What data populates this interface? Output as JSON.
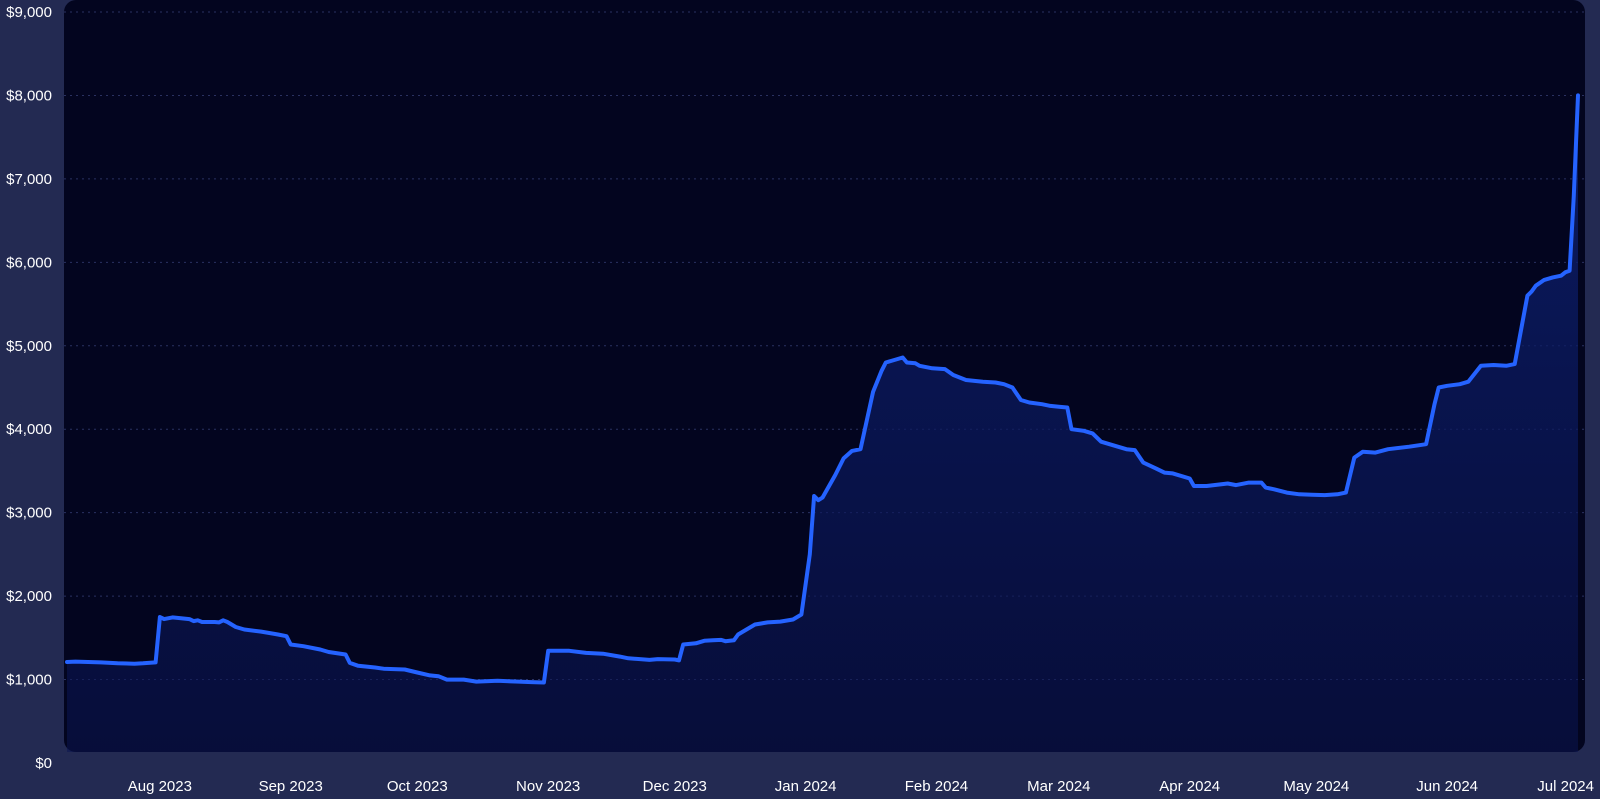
{
  "colors": {
    "background": "#232a52",
    "plot_background": "#03051f",
    "line": "#2563ff",
    "area_fill": "#0a1a5c",
    "grid": "#2a3160",
    "text": "#ffffff"
  },
  "chart_data": {
    "type": "area",
    "title": "",
    "xlabel": "",
    "ylabel": "",
    "ylim": [
      0,
      9000
    ],
    "y_ticks": [
      0,
      1000,
      2000,
      3000,
      4000,
      5000,
      6000,
      7000,
      8000,
      9000
    ],
    "y_tick_labels": [
      "$0",
      "$1,000",
      "$2,000",
      "$3,000",
      "$4,000",
      "$5,000",
      "$6,000",
      "$7,000",
      "$8,000",
      "$9,000"
    ],
    "xlim": [
      "2023-07-10",
      "2024-07-02"
    ],
    "x_ticks": [
      "2023-08-01",
      "2023-09-01",
      "2023-10-01",
      "2023-11-01",
      "2023-12-01",
      "2024-01-01",
      "2024-02-01",
      "2024-03-01",
      "2024-04-01",
      "2024-05-01",
      "2024-06-01",
      "2024-07-01"
    ],
    "x_tick_labels": [
      "Aug 2023",
      "Sep 2023",
      "Oct 2023",
      "Nov 2023",
      "Dec 2023",
      "Jan 2024",
      "Feb 2024",
      "Mar 2024",
      "Apr 2024",
      "May 2024",
      "Jun 2024",
      "Jul 2024"
    ],
    "grid": "horizontal dotted",
    "legend": "none",
    "series": [
      {
        "points": [
          [
            "2023-07-10",
            1210
          ],
          [
            "2023-07-12",
            1215
          ],
          [
            "2023-07-15",
            1210
          ],
          [
            "2023-07-18",
            1205
          ],
          [
            "2023-07-22",
            1195
          ],
          [
            "2023-07-26",
            1190
          ],
          [
            "2023-07-28",
            1195
          ],
          [
            "2023-07-31",
            1205
          ],
          [
            "2023-08-01",
            1750
          ],
          [
            "2023-08-02",
            1725
          ],
          [
            "2023-08-04",
            1745
          ],
          [
            "2023-08-08",
            1725
          ],
          [
            "2023-08-09",
            1700
          ],
          [
            "2023-08-10",
            1710
          ],
          [
            "2023-08-11",
            1690
          ],
          [
            "2023-08-14",
            1690
          ],
          [
            "2023-08-15",
            1685
          ],
          [
            "2023-08-16",
            1710
          ],
          [
            "2023-08-17",
            1690
          ],
          [
            "2023-08-19",
            1630
          ],
          [
            "2023-08-21",
            1600
          ],
          [
            "2023-08-25",
            1575
          ],
          [
            "2023-08-29",
            1540
          ],
          [
            "2023-08-31",
            1520
          ],
          [
            "2023-09-01",
            1420
          ],
          [
            "2023-09-04",
            1400
          ],
          [
            "2023-09-08",
            1360
          ],
          [
            "2023-09-10",
            1330
          ],
          [
            "2023-09-14",
            1300
          ],
          [
            "2023-09-15",
            1200
          ],
          [
            "2023-09-17",
            1165
          ],
          [
            "2023-09-21",
            1145
          ],
          [
            "2023-09-23",
            1130
          ],
          [
            "2023-09-28",
            1120
          ],
          [
            "2023-10-01",
            1085
          ],
          [
            "2023-10-04",
            1050
          ],
          [
            "2023-10-06",
            1040
          ],
          [
            "2023-10-08",
            1000
          ],
          [
            "2023-10-12",
            1000
          ],
          [
            "2023-10-15",
            975
          ],
          [
            "2023-10-20",
            985
          ],
          [
            "2023-10-25",
            975
          ],
          [
            "2023-10-28",
            970
          ],
          [
            "2023-10-31",
            965
          ],
          [
            "2023-11-01",
            1345
          ],
          [
            "2023-11-06",
            1345
          ],
          [
            "2023-11-10",
            1320
          ],
          [
            "2023-11-14",
            1310
          ],
          [
            "2023-11-18",
            1275
          ],
          [
            "2023-11-20",
            1255
          ],
          [
            "2023-11-25",
            1235
          ],
          [
            "2023-11-27",
            1245
          ],
          [
            "2023-12-01",
            1240
          ],
          [
            "2023-12-02",
            1230
          ],
          [
            "2023-12-03",
            1420
          ],
          [
            "2023-12-06",
            1435
          ],
          [
            "2023-12-08",
            1465
          ],
          [
            "2023-12-10",
            1470
          ],
          [
            "2023-12-12",
            1475
          ],
          [
            "2023-12-13",
            1460
          ],
          [
            "2023-12-15",
            1470
          ],
          [
            "2023-12-16",
            1540
          ],
          [
            "2023-12-18",
            1600
          ],
          [
            "2023-12-20",
            1660
          ],
          [
            "2023-12-23",
            1685
          ],
          [
            "2023-12-26",
            1695
          ],
          [
            "2023-12-29",
            1720
          ],
          [
            "2023-12-31",
            1780
          ],
          [
            "2024-01-02",
            2500
          ],
          [
            "2024-01-03",
            3200
          ],
          [
            "2024-01-04",
            3150
          ],
          [
            "2024-01-05",
            3180
          ],
          [
            "2024-01-08",
            3450
          ],
          [
            "2024-01-10",
            3650
          ],
          [
            "2024-01-12",
            3740
          ],
          [
            "2024-01-14",
            3760
          ],
          [
            "2024-01-17",
            4450
          ],
          [
            "2024-01-19",
            4700
          ],
          [
            "2024-01-20",
            4800
          ],
          [
            "2024-01-22",
            4830
          ],
          [
            "2024-01-24",
            4860
          ],
          [
            "2024-01-25",
            4800
          ],
          [
            "2024-01-27",
            4790
          ],
          [
            "2024-01-28",
            4760
          ],
          [
            "2024-01-31",
            4730
          ],
          [
            "2024-02-03",
            4720
          ],
          [
            "2024-02-05",
            4650
          ],
          [
            "2024-02-08",
            4590
          ],
          [
            "2024-02-12",
            4570
          ],
          [
            "2024-02-15",
            4560
          ],
          [
            "2024-02-17",
            4540
          ],
          [
            "2024-02-19",
            4500
          ],
          [
            "2024-02-21",
            4350
          ],
          [
            "2024-02-23",
            4320
          ],
          [
            "2024-02-26",
            4300
          ],
          [
            "2024-02-28",
            4280
          ],
          [
            "2024-03-01",
            4270
          ],
          [
            "2024-03-03",
            4260
          ],
          [
            "2024-03-04",
            4000
          ],
          [
            "2024-03-07",
            3980
          ],
          [
            "2024-03-09",
            3950
          ],
          [
            "2024-03-11",
            3850
          ],
          [
            "2024-03-13",
            3820
          ],
          [
            "2024-03-15",
            3790
          ],
          [
            "2024-03-17",
            3760
          ],
          [
            "2024-03-19",
            3750
          ],
          [
            "2024-03-21",
            3600
          ],
          [
            "2024-03-24",
            3530
          ],
          [
            "2024-03-26",
            3480
          ],
          [
            "2024-03-28",
            3470
          ],
          [
            "2024-04-01",
            3410
          ],
          [
            "2024-04-02",
            3320
          ],
          [
            "2024-04-05",
            3320
          ],
          [
            "2024-04-10",
            3350
          ],
          [
            "2024-04-12",
            3330
          ],
          [
            "2024-04-15",
            3360
          ],
          [
            "2024-04-18",
            3360
          ],
          [
            "2024-04-19",
            3300
          ],
          [
            "2024-04-21",
            3280
          ],
          [
            "2024-04-24",
            3240
          ],
          [
            "2024-04-27",
            3220
          ],
          [
            "2024-04-30",
            3215
          ],
          [
            "2024-05-03",
            3210
          ],
          [
            "2024-05-06",
            3220
          ],
          [
            "2024-05-08",
            3240
          ],
          [
            "2024-05-10",
            3660
          ],
          [
            "2024-05-12",
            3730
          ],
          [
            "2024-05-15",
            3720
          ],
          [
            "2024-05-18",
            3760
          ],
          [
            "2024-05-23",
            3790
          ],
          [
            "2024-05-27",
            3820
          ],
          [
            "2024-05-29",
            4300
          ],
          [
            "2024-05-30",
            4500
          ],
          [
            "2024-06-01",
            4520
          ],
          [
            "2024-06-04",
            4540
          ],
          [
            "2024-06-06",
            4570
          ],
          [
            "2024-06-09",
            4760
          ],
          [
            "2024-06-12",
            4770
          ],
          [
            "2024-06-15",
            4760
          ],
          [
            "2024-06-17",
            4780
          ],
          [
            "2024-06-20",
            5600
          ],
          [
            "2024-06-21",
            5650
          ],
          [
            "2024-06-22",
            5720
          ],
          [
            "2024-06-24",
            5790
          ],
          [
            "2024-06-26",
            5820
          ],
          [
            "2024-06-28",
            5840
          ],
          [
            "2024-06-29",
            5880
          ],
          [
            "2024-06-30",
            5900
          ],
          [
            "2024-07-01",
            6800
          ],
          [
            "2024-07-02",
            8000
          ]
        ]
      }
    ]
  }
}
